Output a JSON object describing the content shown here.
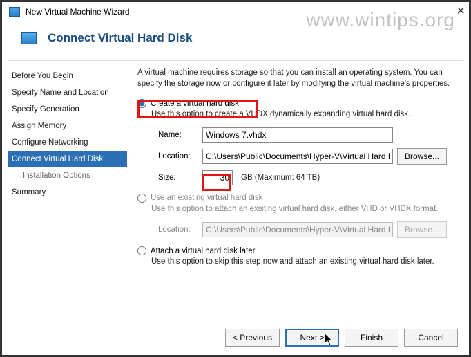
{
  "window": {
    "title": "New Virtual Machine Wizard"
  },
  "watermark": "www.wintips.org",
  "header": {
    "title": "Connect Virtual Hard Disk"
  },
  "sidebar": {
    "steps": [
      "Before You Begin",
      "Specify Name and Location",
      "Specify Generation",
      "Assign Memory",
      "Configure Networking",
      "Connect Virtual Hard Disk",
      "Installation Options",
      "Summary"
    ]
  },
  "main": {
    "intro": "A virtual machine requires storage so that you can install an operating system. You can specify the storage now or configure it later by modifying the virtual machine's properties.",
    "opt1": {
      "label": "Create a virtual hard disk",
      "desc": "Use this option to create a VHDX dynamically expanding virtual hard disk.",
      "nameLabel": "Name:",
      "nameValue": "Windows 7.vhdx",
      "locLabel": "Location:",
      "locValue": "C:\\Users\\Public\\Documents\\Hyper-V\\Virtual Hard Disks\\",
      "browse": "Browse...",
      "sizeLabel": "Size:",
      "sizeValue": "30",
      "sizeUnit": "GB (Maximum: 64 TB)"
    },
    "opt2": {
      "label": "Use an existing virtual hard disk",
      "desc": "Use this option to attach an existing virtual hard disk, either VHD or VHDX format.",
      "locLabel": "Location:",
      "locValue": "C:\\Users\\Public\\Documents\\Hyper-V\\Virtual Hard Disks\\",
      "browse": "Browse..."
    },
    "opt3": {
      "label": "Attach a virtual hard disk later",
      "desc": "Use this option to skip this step now and attach an existing virtual hard disk later."
    }
  },
  "footer": {
    "prev": "< Previous",
    "next": "Next >",
    "finish": "Finish",
    "cancel": "Cancel"
  }
}
